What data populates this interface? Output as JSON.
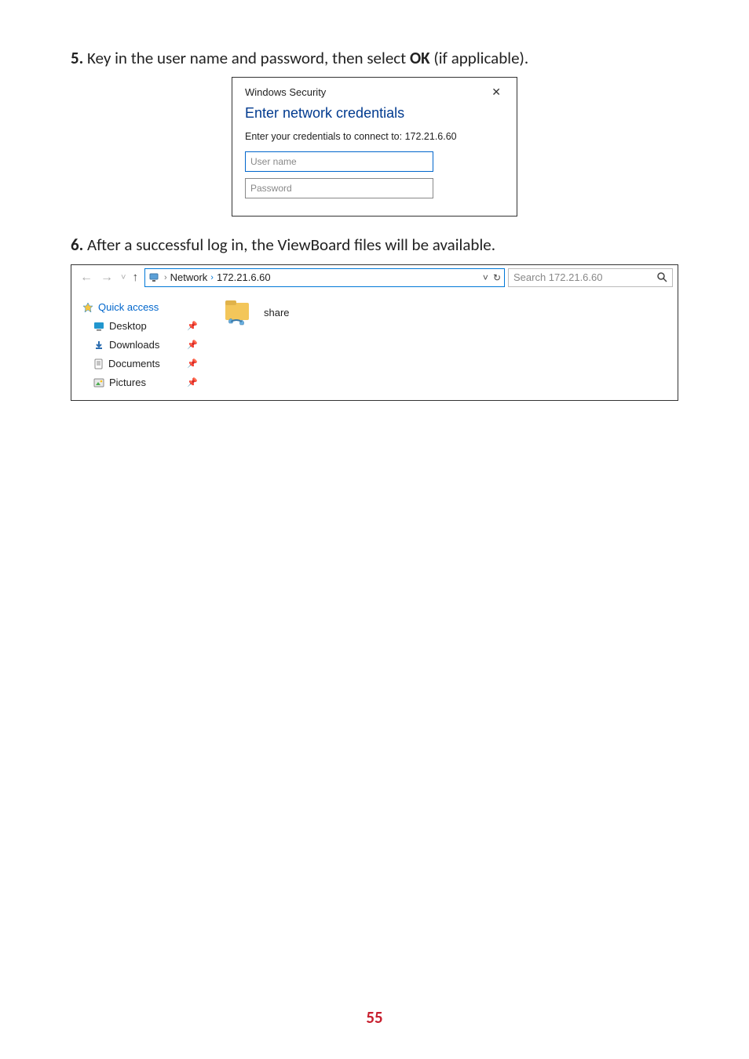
{
  "step5": {
    "num": "5.",
    "text_before": " Key in the user name and password, then select ",
    "ok": "OK",
    "text_after": " (if applicable)."
  },
  "sec_dialog": {
    "title": "Windows Security",
    "heading": "Enter network credentials",
    "message": "Enter your credentials to connect to: 172.21.6.60",
    "user_placeholder": "User name",
    "pass_placeholder": "Password"
  },
  "step6": {
    "num": "6.",
    "text": " After a successful log in, the ViewBoard files will be available."
  },
  "explorer": {
    "breadcrumb": {
      "root": "Network",
      "ip": "172.21.6.60"
    },
    "search_placeholder": "Search 172.21.6.60",
    "sidebar": {
      "quick_access": "Quick access",
      "desktop": "Desktop",
      "downloads": "Downloads",
      "documents": "Documents",
      "pictures": "Pictures"
    },
    "folder": "share"
  },
  "page_number": "55"
}
